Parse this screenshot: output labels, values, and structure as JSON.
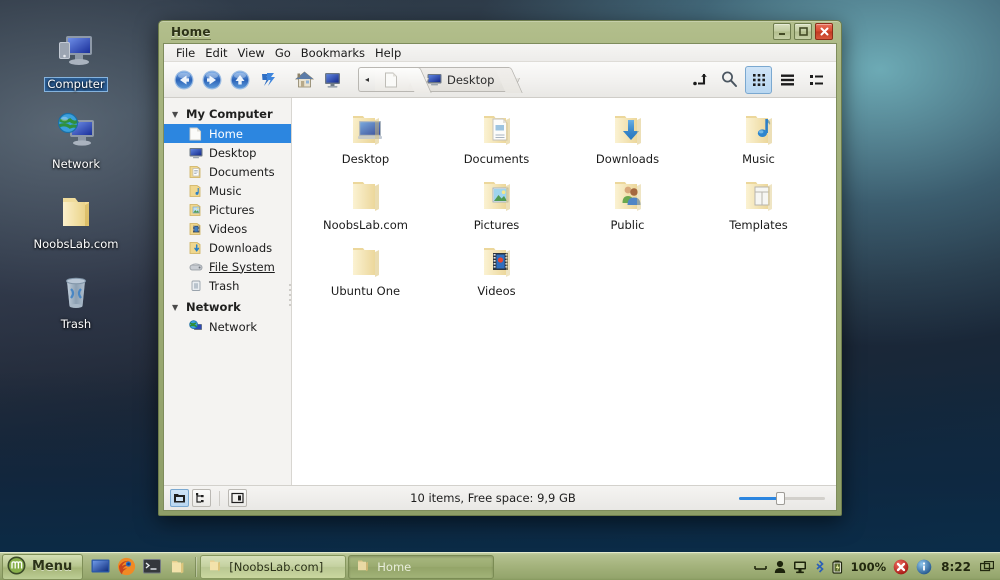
{
  "desktop": {
    "icons": [
      {
        "name": "computer",
        "label": "Computer",
        "icon": "computer-icon",
        "selected": true
      },
      {
        "name": "network",
        "label": "Network",
        "icon": "network-globe-icon",
        "selected": false
      },
      {
        "name": "noobslab",
        "label": "NoobsLab.com",
        "icon": "folder-icon",
        "selected": false
      },
      {
        "name": "trash",
        "label": "Trash",
        "icon": "trash-icon",
        "selected": false
      }
    ]
  },
  "window": {
    "title": "Home",
    "controls": {
      "minimize": "_",
      "maximize": "□",
      "close": "×"
    },
    "menubar": [
      "File",
      "Edit",
      "View",
      "Go",
      "Bookmarks",
      "Help"
    ],
    "toolbar": {
      "back": "Back",
      "forward": "Forward",
      "up": "Up",
      "reload": "Reload",
      "home": "Home",
      "computer": "Computer",
      "collapse": "◂",
      "search": "Search",
      "path_entry": "Toggle Location Entry",
      "view_icons": "Icon View",
      "view_list": "List View",
      "view_compact": "Compact View"
    },
    "breadcrumb": [
      {
        "label": "",
        "icon": "file-page-icon",
        "active": false
      },
      {
        "label": "Desktop",
        "icon": "desktop-monitor-icon",
        "active": true
      }
    ],
    "sidebar": {
      "groups": [
        {
          "name": "My Computer",
          "expanded": true,
          "items": [
            {
              "label": "Home",
              "icon": "home-page-icon",
              "selected": true,
              "link": false
            },
            {
              "label": "Desktop",
              "icon": "desktop-monitor-icon",
              "selected": false,
              "link": false
            },
            {
              "label": "Documents",
              "icon": "documents-folder-icon",
              "selected": false,
              "link": false
            },
            {
              "label": "Music",
              "icon": "music-folder-icon",
              "selected": false,
              "link": false
            },
            {
              "label": "Pictures",
              "icon": "pictures-folder-icon",
              "selected": false,
              "link": false
            },
            {
              "label": "Videos",
              "icon": "videos-folder-icon",
              "selected": false,
              "link": false
            },
            {
              "label": "Downloads",
              "icon": "downloads-folder-icon",
              "selected": false,
              "link": false
            },
            {
              "label": "File System",
              "icon": "harddisk-icon",
              "selected": false,
              "link": true
            },
            {
              "label": "Trash",
              "icon": "trash-small-icon",
              "selected": false,
              "link": false
            }
          ]
        },
        {
          "name": "Network",
          "expanded": true,
          "items": [
            {
              "label": "Network",
              "icon": "network-globe-icon",
              "selected": false,
              "link": false
            }
          ]
        }
      ]
    },
    "files": [
      {
        "label": "Desktop",
        "icon": "folder-desktop-icon"
      },
      {
        "label": "Documents",
        "icon": "folder-documents-icon"
      },
      {
        "label": "Downloads",
        "icon": "folder-downloads-icon"
      },
      {
        "label": "Music",
        "icon": "folder-music-icon"
      },
      {
        "label": "NoobsLab.com",
        "icon": "folder-plain-icon"
      },
      {
        "label": "Pictures",
        "icon": "folder-pictures-icon"
      },
      {
        "label": "Public",
        "icon": "folder-public-icon"
      },
      {
        "label": "Templates",
        "icon": "folder-templates-icon"
      },
      {
        "label": "Ubuntu One",
        "icon": "folder-plain-icon"
      },
      {
        "label": "Videos",
        "icon": "folder-videos-icon"
      }
    ],
    "statusbar": {
      "text": "10 items, Free space: 9,9 GB",
      "buttons": [
        {
          "name": "show-folders",
          "active": true
        },
        {
          "name": "show-tree",
          "active": false
        },
        {
          "name": "toggle-sidebar",
          "active": false
        }
      ],
      "zoom_percent": 48
    }
  },
  "taskbar": {
    "menu_label": "Menu",
    "quick_launch": [
      {
        "name": "show-desktop-icon"
      },
      {
        "name": "firefox-icon"
      },
      {
        "name": "terminal-icon"
      },
      {
        "name": "file-manager-icon"
      }
    ],
    "tasks": [
      {
        "label": "[NoobsLab.com]",
        "icon": "folder-icon",
        "active": false
      },
      {
        "label": "Home",
        "icon": "folder-icon",
        "active": true
      }
    ],
    "tray": {
      "items": [
        {
          "name": "keyboard-icon"
        },
        {
          "name": "user-icon"
        },
        {
          "name": "display-icon"
        },
        {
          "name": "bluetooth-icon"
        },
        {
          "name": "battery-icon"
        }
      ],
      "battery": "100%",
      "update_error": "update-error-icon",
      "info": "info-icon",
      "clock": "8:22",
      "workspace": "workspace-switcher-icon"
    }
  },
  "colors": {
    "window_frame": "#a3b27b",
    "selection": "#2c86e0",
    "folder": "#f3d98b",
    "accent_close": "#d8492f"
  }
}
